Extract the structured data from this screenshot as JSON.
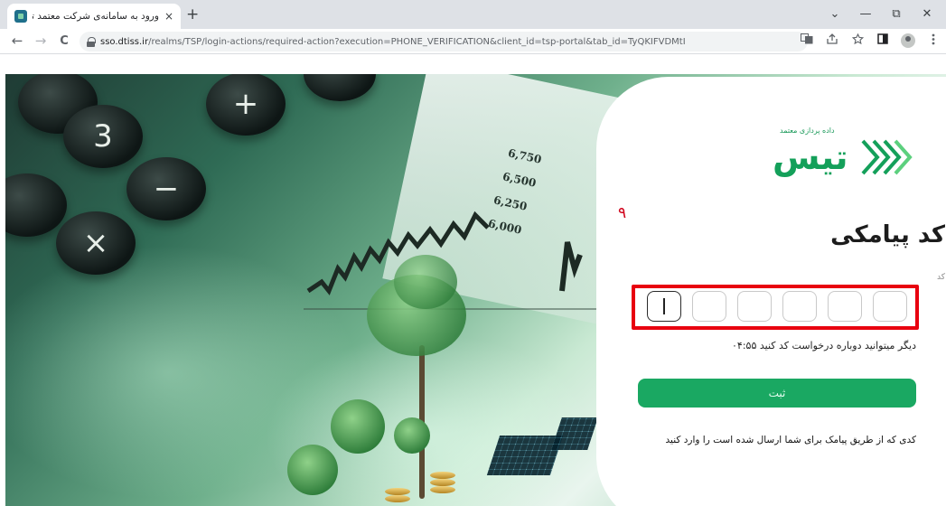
{
  "browser": {
    "tab_title": "ورود به سامانه‌ی شرکت معتمد تیس",
    "tab_close": "×",
    "new_tab": "+",
    "url_host": "sso.dtiss.ir",
    "url_path": "/realms/TSP/login-actions/required-action?execution=PHONE_VERIFICATION&client_id=tsp-portal&tab_id=TyQKIFVDMtI",
    "window_controls": [
      "⌄",
      "—",
      "⧉",
      "✕"
    ],
    "nav": {
      "back": "←",
      "forward": "→",
      "reload": "C"
    },
    "toolbar_icons": [
      "translate-icon",
      "share-icon",
      "bookmark-star-icon",
      "side-panel-icon",
      "profile-icon",
      "menu-icon"
    ]
  },
  "hero": {
    "keys": [
      "3",
      "−",
      "×",
      "+"
    ],
    "chart_numbers": [
      "6,750",
      "6,500",
      "6,250",
      "6,000"
    ]
  },
  "login": {
    "logo_tagline": "داده پردازی معتمد",
    "logo_word": "تیس",
    "title": "کد پیامکی",
    "code_label": "کد",
    "code_digits": [
      "",
      "",
      "",
      "",
      "",
      ""
    ],
    "timer_text": "۰۴:۵۵ دیگر میتوانید دوباره درخواست کد کنید",
    "submit_label": "ثبت",
    "footer_text": "کدی که از طریق پیامک برای شما ارسال شده است را وارد کنید"
  },
  "annotation": {
    "step_number": "۹",
    "color": "#e8000f"
  },
  "colors": {
    "brand_green": "#1aa862",
    "highlight_red": "#e8000f"
  }
}
